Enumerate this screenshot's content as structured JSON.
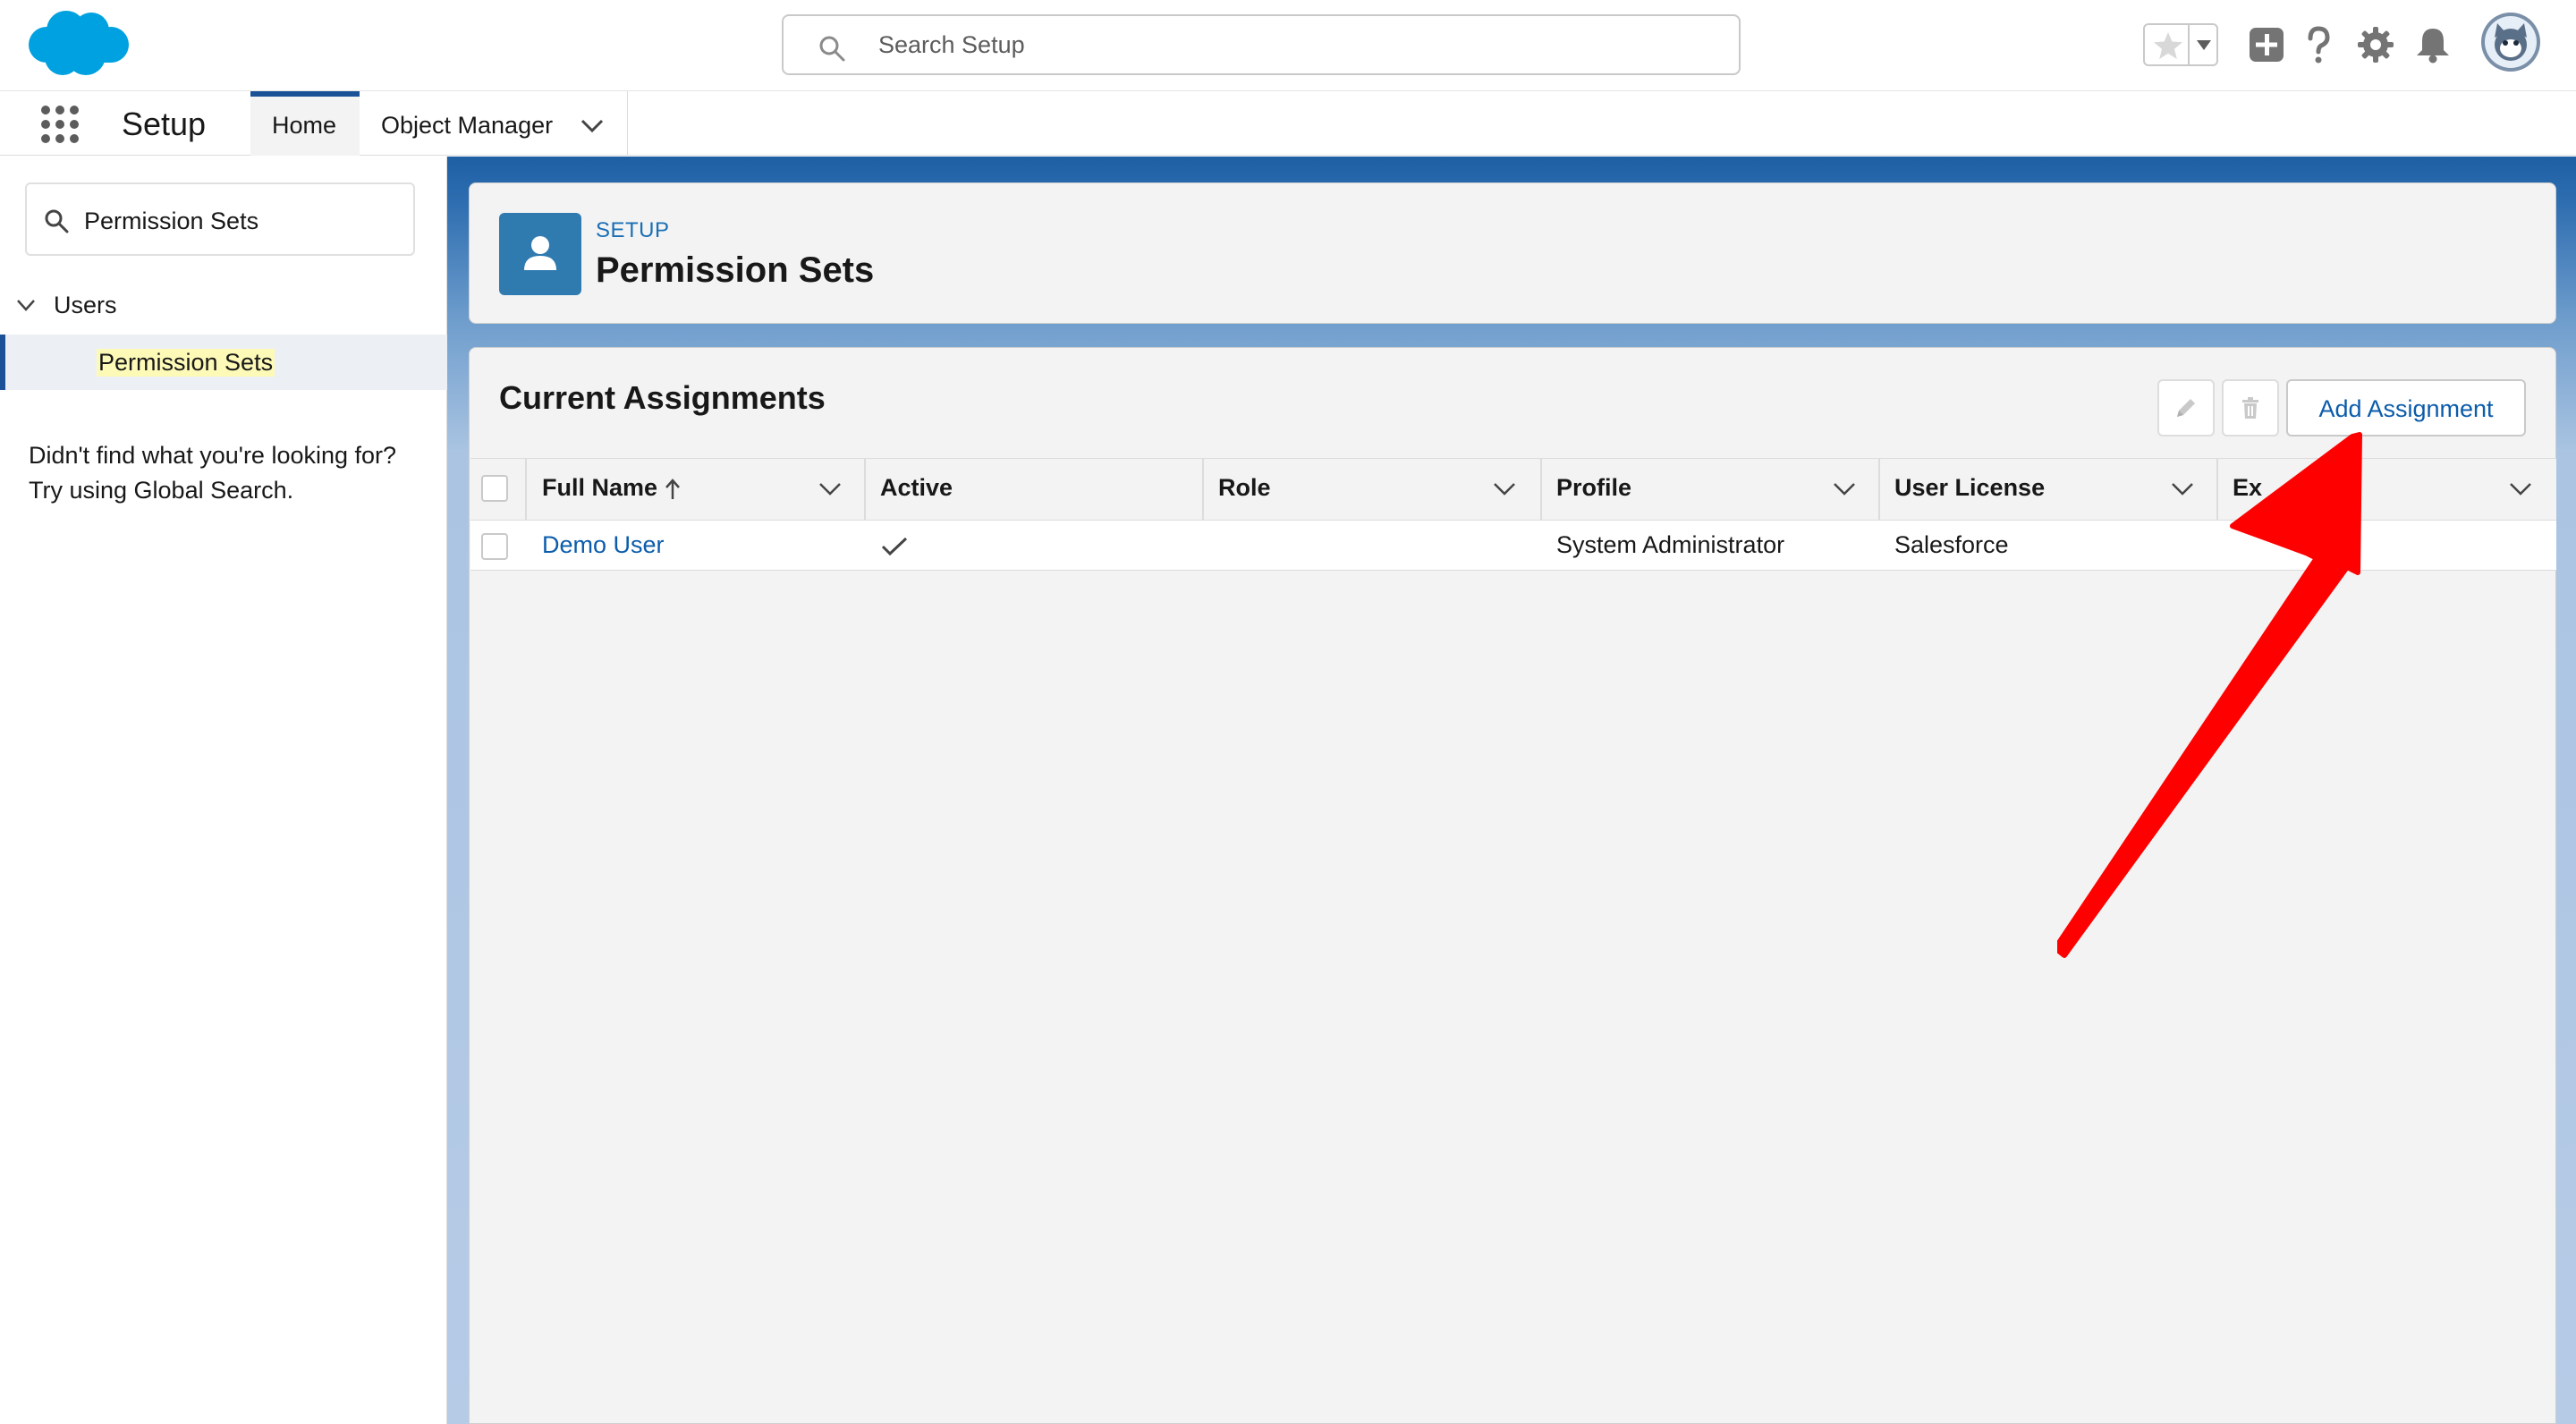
{
  "search": {
    "placeholder": "Search Setup"
  },
  "header_icons": [
    "favorites-star-icon",
    "add-icon",
    "help-icon",
    "settings-gear-icon",
    "notifications-bell-icon",
    "user-avatar"
  ],
  "context_bar": {
    "app_name": "Setup",
    "tabs": [
      {
        "label": "Home",
        "active": true
      },
      {
        "label": "Object Manager",
        "has_menu": true
      }
    ]
  },
  "sidebar": {
    "quick_find_value": "Permission Sets",
    "tree": {
      "parent": "Users",
      "child": "Permission Sets"
    },
    "help_line1": "Didn't find what you're looking for?",
    "help_line2": "Try using Global Search."
  },
  "page_header": {
    "breadcrumb": "SETUP",
    "title": "Permission Sets"
  },
  "card": {
    "title": "Current Assignments",
    "add_button": "Add Assignment"
  },
  "table": {
    "columns": [
      {
        "label": "Full Name",
        "sorted": "ascending"
      },
      {
        "label": "Active"
      },
      {
        "label": "Role"
      },
      {
        "label": "Profile"
      },
      {
        "label": "User License"
      },
      {
        "label": "Ex"
      }
    ],
    "rows": [
      {
        "full_name": "Demo User",
        "active": true,
        "role": "",
        "profile": "System Administrator",
        "user_license": "Salesforce",
        "expiration": ""
      }
    ]
  },
  "colors": {
    "brand_blue": "#0b5cab",
    "header_band": "#1e5fa4",
    "annotation_arrow": "#ff0000"
  }
}
